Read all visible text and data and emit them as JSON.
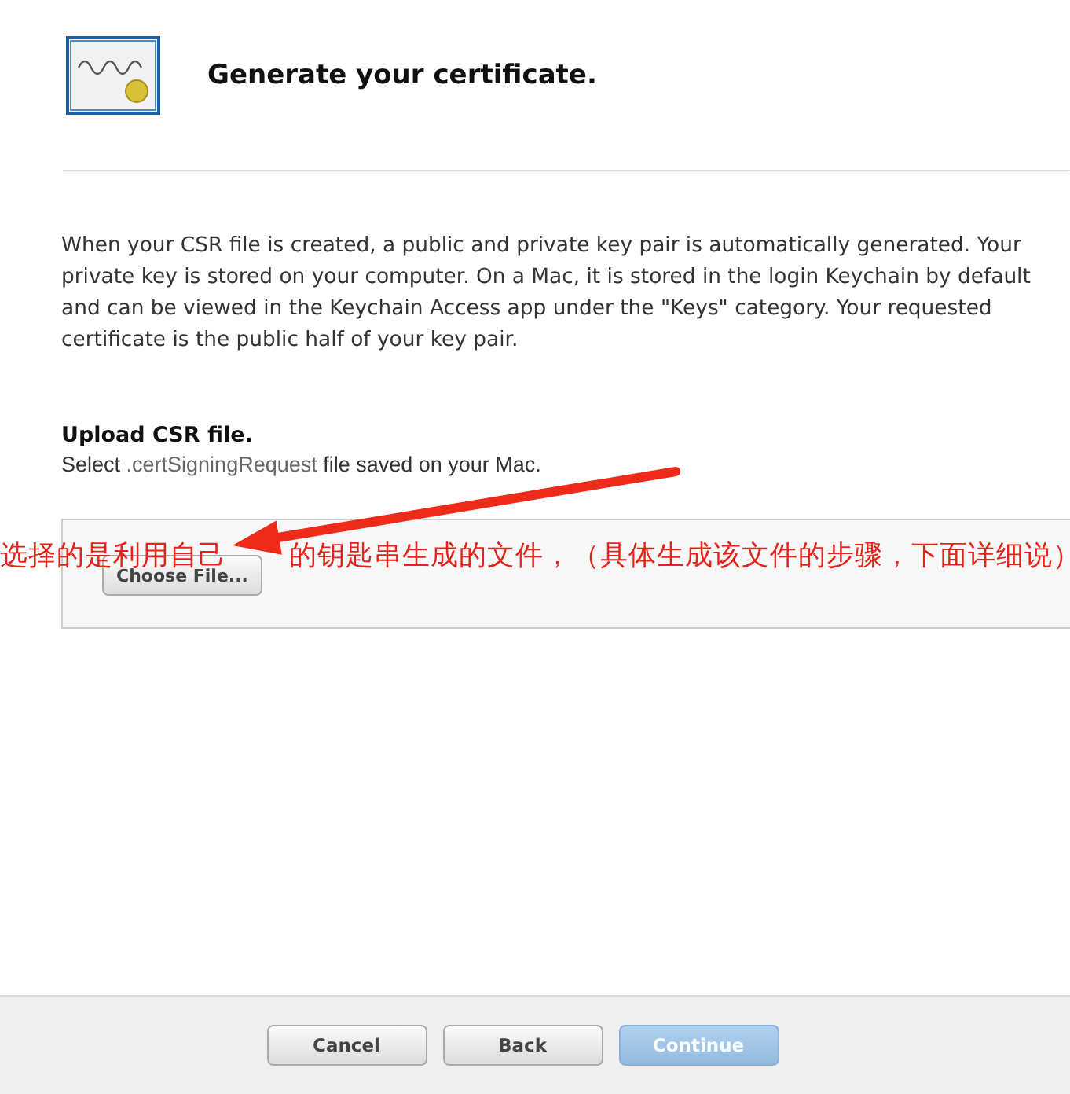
{
  "header": {
    "title": "Generate your certificate."
  },
  "intro": "When your CSR file is created, a public and private key pair is automatically generated. Your private key is stored on your computer. On a Mac, it is stored in the login Keychain by default and can be viewed in the Keychain Access app under the \"Keys\" category. Your requested certificate is the public half of your key pair.",
  "upload": {
    "heading": "Upload CSR file.",
    "hint_before": "Select ",
    "hint_code": ".certSigningRequest",
    "hint_after": " file saved on your Mac.",
    "button": "Choose File..."
  },
  "annotation": [
    "选择的是利用自己",
    "的钥匙串生成的文件，（具体生成该文件的步骤，下面详细说）"
  ],
  "buttons": [
    {
      "label": "Cancel",
      "disabled": false,
      "primary": false
    },
    {
      "label": "Back",
      "disabled": false,
      "primary": false
    },
    {
      "label": "Continue",
      "disabled": true,
      "primary": true
    }
  ]
}
